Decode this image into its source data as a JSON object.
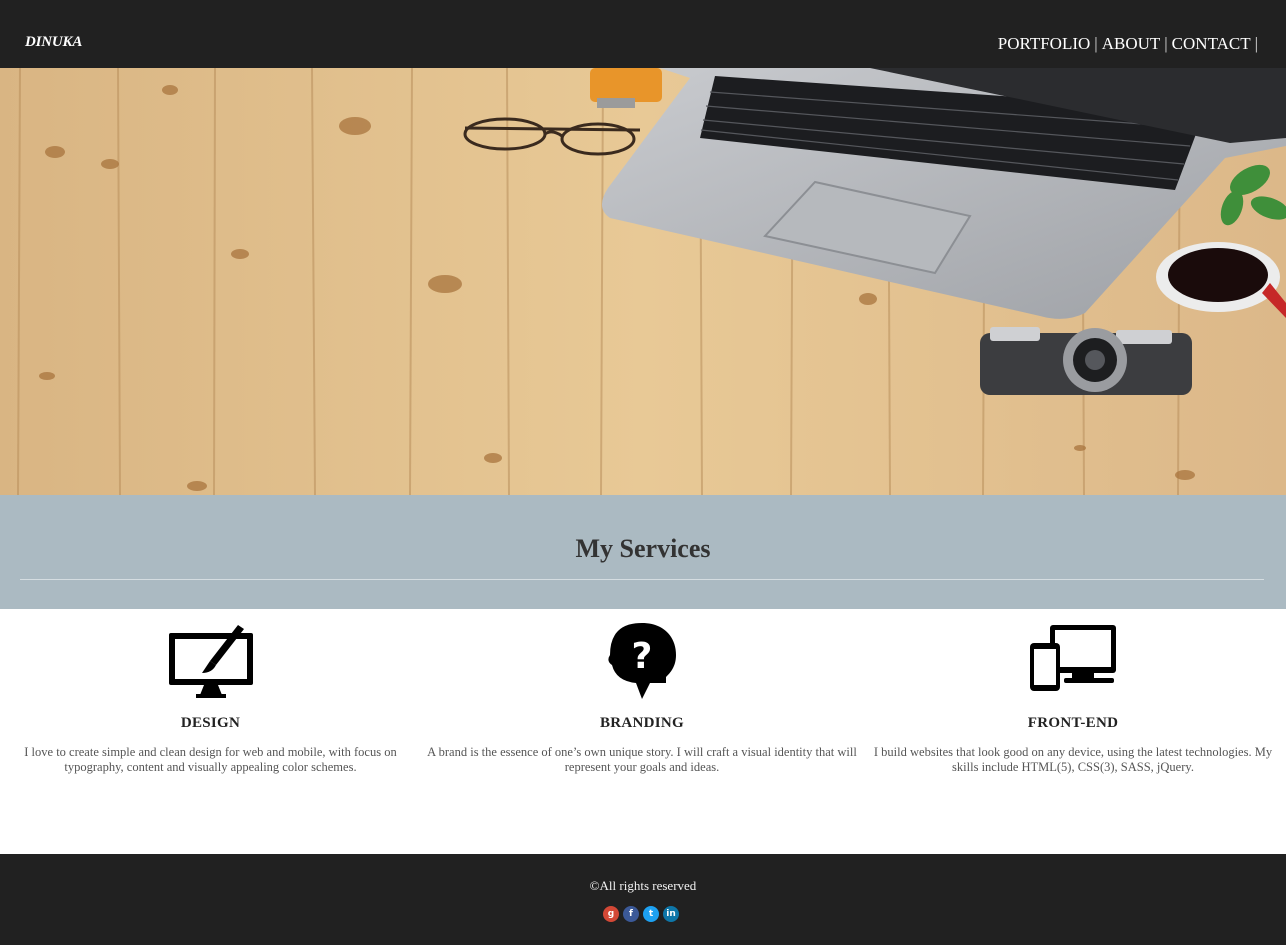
{
  "header": {
    "brand": "DINUKA",
    "nav": [
      {
        "label": "PORTFOLIO"
      },
      {
        "label": "ABOUT"
      },
      {
        "label": "CONTACT"
      }
    ],
    "separator": "|"
  },
  "hero": {
    "image": "desk-with-laptop-glasses-camera-coffee",
    "background_color": "#e2c190"
  },
  "services": {
    "title": "My Services",
    "items": [
      {
        "icon": "monitor-brush-icon",
        "title": "DESIGN",
        "text": "I love to create simple and clean design for web and mobile, with focus on typography, content and visually appealing color schemes."
      },
      {
        "icon": "head-question-icon",
        "title": "BRANDING",
        "text": "A brand is the essence of one’s own unique story. I will craft a visual identity that will represent your goals and ideas."
      },
      {
        "icon": "devices-icon",
        "title": "FRONT-END",
        "text": "I build websites that look good on any device, using the latest technologies. My skills include HTML(5), CSS(3), SASS, jQuery."
      }
    ]
  },
  "footer": {
    "copyright": "©All rights reserved",
    "social": [
      {
        "icon": "google-plus-icon",
        "glyph": "g",
        "color": "#d34836"
      },
      {
        "icon": "facebook-icon",
        "glyph": "f",
        "color": "#3b5998"
      },
      {
        "icon": "twitter-icon",
        "glyph": "t",
        "color": "#1da1f2"
      },
      {
        "icon": "linkedin-icon",
        "glyph": "in",
        "color": "#0e76a8"
      }
    ]
  },
  "colors": {
    "header_bg": "#212121",
    "services_band": "#abbac2",
    "footer_bg": "#212121"
  }
}
